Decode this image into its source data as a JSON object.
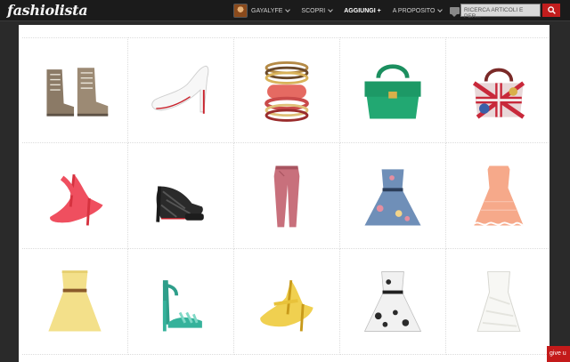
{
  "header": {
    "logo": "fashiolista",
    "user": "GAYALYFE",
    "discover": "SCOPRI",
    "add": "AGGIUNGI +",
    "about": "A PROPOSITO",
    "search_placeholder": "RICERCA ARTICOLI E PER..."
  },
  "colors": {
    "accent": "#c11d1d",
    "topbar": "#1b1b1b",
    "background": "#2a2a2a"
  },
  "products": [
    {
      "icon": "lace-up-ankle-boots-icon"
    },
    {
      "icon": "white-platform-pumps-icon"
    },
    {
      "icon": "stacked-bangles-icon"
    },
    {
      "icon": "green-tote-bag-icon"
    },
    {
      "icon": "union-jack-bag-icon"
    },
    {
      "icon": "coral-peep-toe-heels-icon"
    },
    {
      "icon": "black-lace-pumps-icon"
    },
    {
      "icon": "pink-skinny-jeans-icon"
    },
    {
      "icon": "floral-strapless-dress-icon"
    },
    {
      "icon": "peach-lace-dress-icon"
    },
    {
      "icon": "yellow-strapless-dress-icon"
    },
    {
      "icon": "turquoise-studded-sandals-icon"
    },
    {
      "icon": "yellow-mary-jane-heels-icon"
    },
    {
      "icon": "black-white-floral-dress-icon"
    },
    {
      "icon": "white-strapless-dress-icon"
    }
  ],
  "floating_tab": {
    "label": "give u"
  }
}
